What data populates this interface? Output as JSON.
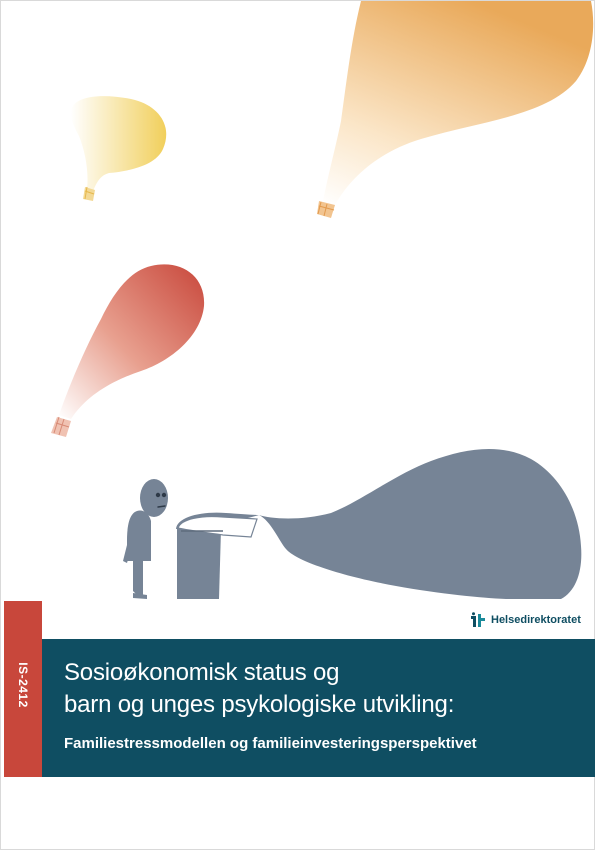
{
  "cover": {
    "report_number": "IS-2412",
    "title_line_1": "Sosioøkonomisk status og",
    "title_line_2": "barn og unges psykologiske utvikling:",
    "subtitle": "Familiestressmodellen og familieinvesteringsperspektivet",
    "publisher_logo_text": "Helsedirektoratet"
  },
  "colors": {
    "title_band": "#0f4e62",
    "spine_tab": "#c8473b",
    "balloon_orange": "#e9a95a",
    "balloon_yellow": "#f1cf5b",
    "balloon_red": "#c8473b",
    "figure_grey": "#768496"
  },
  "icons": {
    "logo": "helsedirektoratet-logo-icon"
  }
}
